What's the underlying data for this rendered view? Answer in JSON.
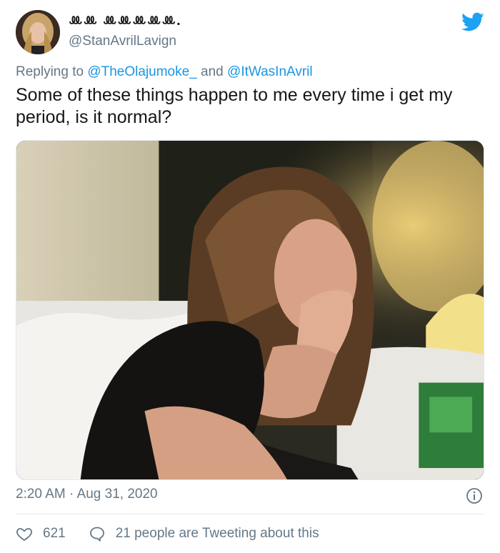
{
  "tweet": {
    "display_name": "ꔛꔛ ꔛꔛꔛꔛꔛ.",
    "handle": "@StanAvrilLavign",
    "reply_prefix": "Replying to",
    "reply_mention_1": "@TheOlajumoke_",
    "reply_and": "and",
    "reply_mention_2": "@ItWasInAvril",
    "text": "Some of these things happen to me every time i get my period, is it normal?",
    "timestamp": "2:20 AM · Aug 31, 2020",
    "likes": "621",
    "conversation": "21 people are Tweeting about this"
  },
  "icons": {
    "brand": "twitter-bird-icon",
    "info": "info-icon",
    "like": "heart-icon",
    "reply": "speech-bubble-icon"
  },
  "colors": {
    "brand_blue": "#1da1f2",
    "mention_blue": "#1b95e0",
    "secondary_text": "#657786",
    "primary_text": "#14171a",
    "divider": "#e1e8ed"
  }
}
